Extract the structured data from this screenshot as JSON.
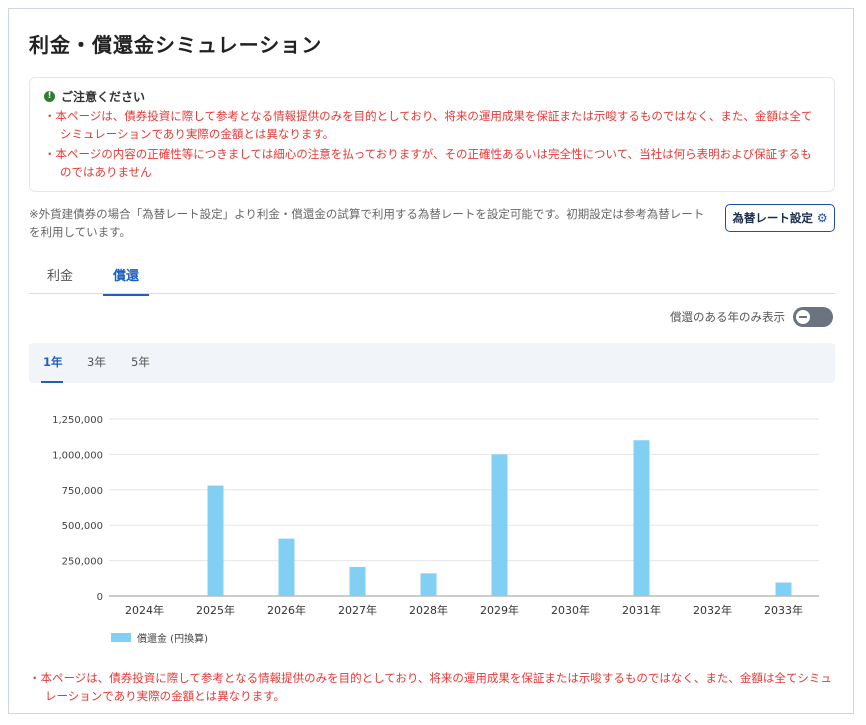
{
  "page": {
    "title": "利金・償還金シミュレーション"
  },
  "notice": {
    "heading": "ご注意ください",
    "lines": [
      "・本ページは、債券投資に際して参考となる情報提供のみを目的としており、将来の運用成果を保証または示唆するものではなく、また、金額は全てシミュレーションであり実際の金額とは異なります。",
      "・本ページの内容の正確性等につきましては細心の注意を払っておりますが、その正確性あるいは完全性について、当社は何ら表明および保証するものではありません"
    ]
  },
  "fx_note": "※外貨建債券の場合「為替レート設定」より利金・償還金の試算で利用する為替レートを設定可能です。初期設定は参考為替レートを利用しています。",
  "fx_button": {
    "label": "為替レート設定",
    "icon": "gear-icon"
  },
  "tabs": [
    {
      "label": "利金",
      "active": false
    },
    {
      "label": "償還",
      "active": true
    }
  ],
  "toggle": {
    "label": "償還のある年のみ表示",
    "on": false
  },
  "periods": [
    {
      "label": "1年",
      "active": true
    },
    {
      "label": "3年",
      "active": false
    },
    {
      "label": "5年",
      "active": false
    }
  ],
  "chart_data": {
    "type": "bar",
    "categories": [
      "2024年",
      "2025年",
      "2026年",
      "2027年",
      "2028年",
      "2029年",
      "2030年",
      "2031年",
      "2032年",
      "2033年"
    ],
    "series": [
      {
        "name": "償還金 (円換算)",
        "values": [
          0,
          780000,
          405000,
          205000,
          160000,
          1000000,
          0,
          1100000,
          0,
          95000
        ],
        "color": "#81d0f4"
      }
    ],
    "yticks": [
      "0",
      "250,000",
      "500,000",
      "750,000",
      "1,000,000",
      "1,250,000"
    ],
    "ylim": [
      0,
      1250000
    ],
    "grid": true,
    "legend": "bottom-left"
  },
  "footer_note": "・本ページは、債券投資に際して参考となる情報提供のみを目的としており、将来の運用成果を保証または示唆するものではなく、また、金額は全てシミュレーションであり実際の金額とは異なります。",
  "colors": {
    "accent": "#1e5fc1",
    "warning": "#e53935",
    "bar": "#81d0f4"
  }
}
